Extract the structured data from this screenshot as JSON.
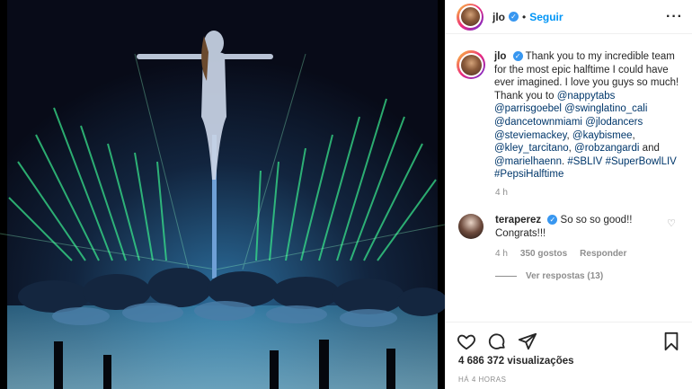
{
  "post": {
    "username": "jlo",
    "separator": "•",
    "follow_label": "Seguir",
    "more_label": "···"
  },
  "caption": {
    "username": "jlo",
    "text_intro": "Thank you to my incredible team for the most epic halftime I could have ever imagined. I love you guys so much! Thank you to ",
    "mentions": [
      "@nappytabs",
      "@parrisgoebel",
      "@swinglatino_cali",
      "@dancetownmiami",
      "@jlodancers",
      "@steviemackey",
      "@kaybismee",
      "@kley_tarcitano",
      "@robzangardi",
      "@marielhaenn"
    ],
    "hashtags": [
      "#SBLIV",
      "#SuperBowlLIV",
      "#PepsiHalftime"
    ],
    "and_word": "and",
    "comma": ",",
    "age": "4 h"
  },
  "comment": {
    "username": "teraperez",
    "text": "So so so good!! Congrats!!!",
    "age": "4 h",
    "likes": "350 gostos",
    "reply_label": "Responder",
    "view_replies_label": "Ver respostas (13)"
  },
  "footer": {
    "views": "4 686 372 visualizações",
    "timestamp": "HÁ 4 HORAS"
  },
  "icons": {
    "like": "heart-icon",
    "comment": "comment-icon",
    "share": "share-icon",
    "save": "bookmark-icon",
    "verified": "verified-badge-icon"
  },
  "colors": {
    "accent": "#0095f6",
    "link": "#00376b",
    "muted": "#8e8e8e",
    "text": "#262626",
    "laser_green": "#37e08a"
  }
}
